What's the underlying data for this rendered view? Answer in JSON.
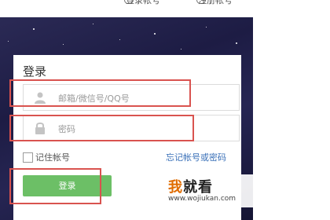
{
  "header": {
    "link_1": "登录帐号",
    "link_2": "注册帐号"
  },
  "login": {
    "title": "登录",
    "account_placeholder": "邮箱/微信号/QQ号",
    "password_placeholder": "密码",
    "remember_label": "记住帐号",
    "forgot_link": "忘记帐号或密码",
    "login_button": "登录"
  },
  "watermark": {
    "brand_first": "我",
    "brand_rest": "就看",
    "url": "www.wojiukan.com"
  },
  "icons": {
    "account": "user-icon",
    "password": "lock-icon"
  },
  "colors": {
    "banner": "#1d1c44",
    "button": "#6cbf66",
    "highlight": "#d9534f",
    "link": "#3a70b8"
  }
}
